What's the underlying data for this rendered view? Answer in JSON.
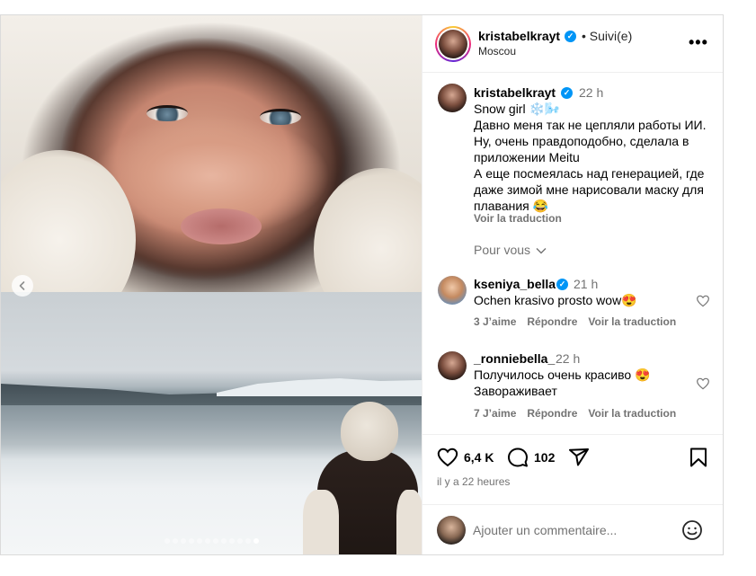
{
  "header": {
    "username": "kristabelkrayt",
    "follow_status": "• Suivi(e)",
    "location": "Moscou",
    "more_icon": "more-horizontal-icon"
  },
  "caption": {
    "username": "kristabelkrayt",
    "time": "22 h",
    "text": "Snow girl ❄️🌬️\nДавно меня так не цепляли работы ИИ. Ну, очень правдоподобно, сделала в приложении Meitu\nА еще посмеялась над генерацией, где даже зимой мне нарисовали маску для плавания 😂",
    "translate": "Voir la traduction",
    "pour_vous": "Pour vous"
  },
  "comments": [
    {
      "username": "kseniya_bella",
      "time": "21 h",
      "text": "Ochen krasivo prosto wow😍",
      "likes": "3 J’aime",
      "reply": "Répondre",
      "translate": "Voir la traduction"
    },
    {
      "username": "_ronniebella_",
      "time": "22 h",
      "text": "Получилось очень красиво 😍\nЗавораживает",
      "likes": "7 J’aime",
      "reply": "Répondre",
      "translate": "Voir la traduction"
    }
  ],
  "actions": {
    "likes": "6,4 K",
    "comments": "102"
  },
  "timestamp": "il y a 22 heures",
  "comment_input": {
    "placeholder": "Ajouter un commentaire..."
  },
  "carousel": {
    "total": 12,
    "active_index": 11
  }
}
